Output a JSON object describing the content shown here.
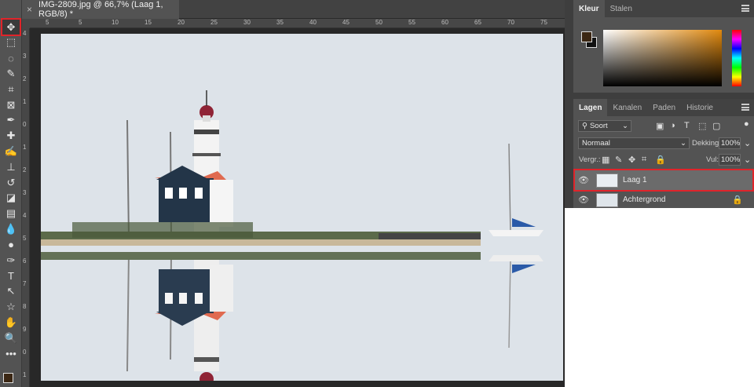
{
  "document": {
    "tab_title": "IMG-2809.jpg @ 66,7% (Laag 1, RGB/8) *",
    "close_glyph": "×",
    "ruler_h_labels": [
      "5",
      "5",
      "10",
      "15",
      "20",
      "25",
      "30",
      "35",
      "40",
      "45",
      "50",
      "55",
      "60",
      "65",
      "70",
      "75"
    ],
    "ruler_v_labels": [
      "4",
      "3",
      "2",
      "1",
      "0",
      "1",
      "2",
      "3",
      "4",
      "5",
      "6",
      "7",
      "8",
      "9",
      "0",
      "1"
    ]
  },
  "tools": [
    {
      "name": "move-tool",
      "glyph": "✥"
    },
    {
      "name": "marquee-tool",
      "glyph": "⬚"
    },
    {
      "name": "lasso-tool",
      "glyph": "◌"
    },
    {
      "name": "quick-select-tool",
      "glyph": "✎"
    },
    {
      "name": "crop-tool",
      "glyph": "⌗"
    },
    {
      "name": "frame-tool",
      "glyph": "⊠"
    },
    {
      "name": "eyedropper-tool",
      "glyph": "✒"
    },
    {
      "name": "healing-tool",
      "glyph": "✚"
    },
    {
      "name": "brush-tool",
      "glyph": "✍"
    },
    {
      "name": "stamp-tool",
      "glyph": "⊥"
    },
    {
      "name": "history-brush-tool",
      "glyph": "↺"
    },
    {
      "name": "eraser-tool",
      "glyph": "◪"
    },
    {
      "name": "gradient-tool",
      "glyph": "▤"
    },
    {
      "name": "blur-tool",
      "glyph": "💧"
    },
    {
      "name": "dodge-tool",
      "glyph": "●"
    },
    {
      "name": "pen-tool",
      "glyph": "✑"
    },
    {
      "name": "type-tool",
      "glyph": "T"
    },
    {
      "name": "path-select-tool",
      "glyph": "↖"
    },
    {
      "name": "shape-tool",
      "glyph": "☆"
    },
    {
      "name": "hand-tool",
      "glyph": "✋"
    },
    {
      "name": "zoom-tool",
      "glyph": "🔍"
    },
    {
      "name": "more-tools",
      "glyph": "•••"
    }
  ],
  "color_panel": {
    "tabs": [
      "Kleur",
      "Stalen"
    ],
    "foreground": "#3b2714",
    "background": "#111111"
  },
  "layers_panel": {
    "tabs": [
      "Lagen",
      "Kanalen",
      "Paden",
      "Historie"
    ],
    "filter_label": "Soort",
    "blend_mode": "Normaal",
    "opacity_label": "Dekking:",
    "opacity_value": "100%",
    "lock_label": "Vergr.:",
    "fill_label": "Vul:",
    "fill_value": "100%",
    "layers": [
      {
        "name": "Laag 1",
        "selected": true
      },
      {
        "name": "Achtergrond",
        "selected": false
      }
    ]
  },
  "colors": {
    "accent_highlight": "#e0242a",
    "panel_bg": "#535353"
  }
}
